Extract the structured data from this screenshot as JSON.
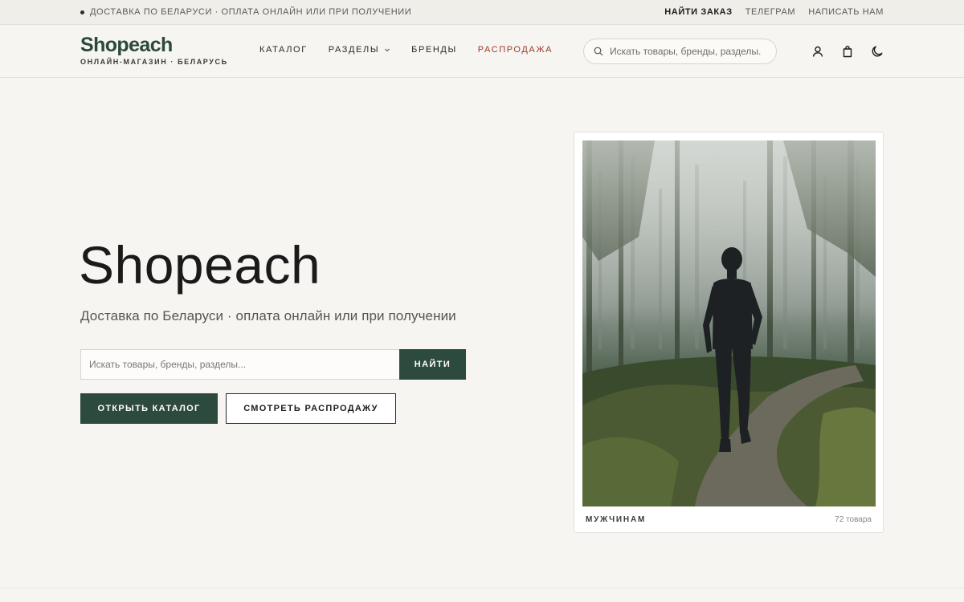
{
  "topbar": {
    "announcement": "ДОСТАВКА ПО БЕЛАРУСИ · ОПЛАТА ОНЛАЙН ИЛИ ПРИ ПОЛУЧЕНИИ",
    "links": {
      "find_order": "НАЙТИ ЗАКАЗ",
      "telegram": "ТЕЛЕГРАМ",
      "contact": "НАПИСАТЬ НАМ"
    }
  },
  "header": {
    "logo": {
      "name": "Shopeach",
      "tagline": "ОНЛАЙН-МАГАЗИН · БЕЛАРУСЬ"
    },
    "nav": {
      "catalog": "КАТАЛОГ",
      "sections": "РАЗДЕЛЫ",
      "brands": "БРЕНДЫ",
      "sale": "РАСПРОДАЖА"
    },
    "search": {
      "placeholder": "Искать товары, бренды, разделы."
    },
    "icons": [
      "user-icon",
      "shopping-bag-icon",
      "moon-icon"
    ]
  },
  "hero": {
    "title": "Shopeach",
    "subtitle": "Доставка по Беларуси · оплата онлайн или при получении",
    "search": {
      "placeholder": "Искать товары, бренды, разделы...",
      "button": "НАЙТИ"
    },
    "primary_button": "ОТКРЫТЬ КАТАЛОГ",
    "secondary_button": "СМОТРЕТЬ РАСПРОДАЖУ"
  },
  "category_card": {
    "label": "МУЖЧИНАМ",
    "count": "72 товара"
  },
  "colors": {
    "brand_green": "#2d4a3e",
    "sale_red": "#9a3b2a",
    "background": "#f6f5f1"
  }
}
